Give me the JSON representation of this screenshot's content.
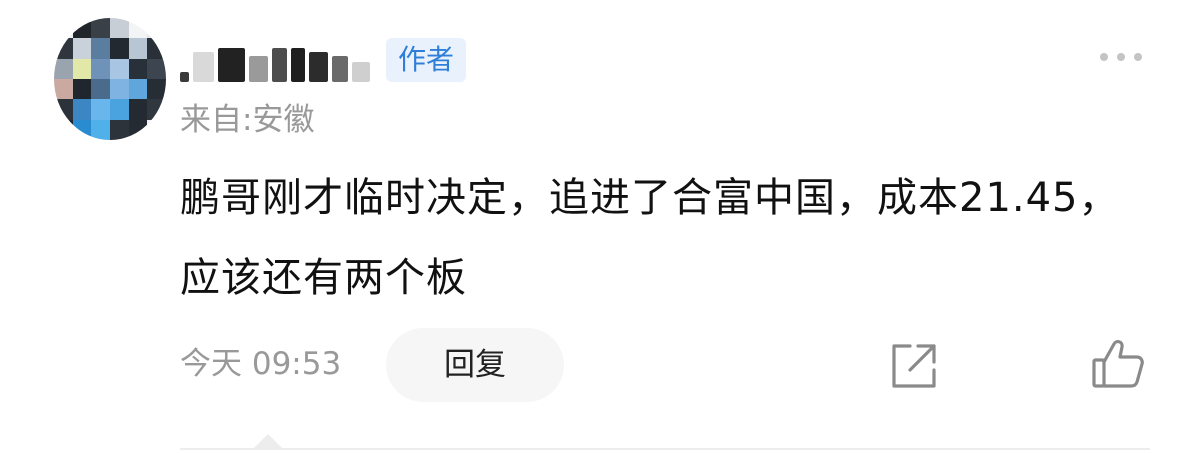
{
  "comment": {
    "author_badge": "作者",
    "location": "来自:安徽",
    "content": "鹏哥刚才临时决定，追进了合富中国，成本21.45，应该还有两个板",
    "timestamp": "今天 09:53",
    "reply_label": "回复"
  },
  "icons": {
    "more": "more-dots-icon",
    "share": "share-icon",
    "like": "thumbs-up-icon"
  },
  "colors": {
    "badge_text": "#2f7fd9",
    "badge_bg": "#e9f2fc",
    "meta_text": "#999999",
    "icon": "#888888"
  }
}
